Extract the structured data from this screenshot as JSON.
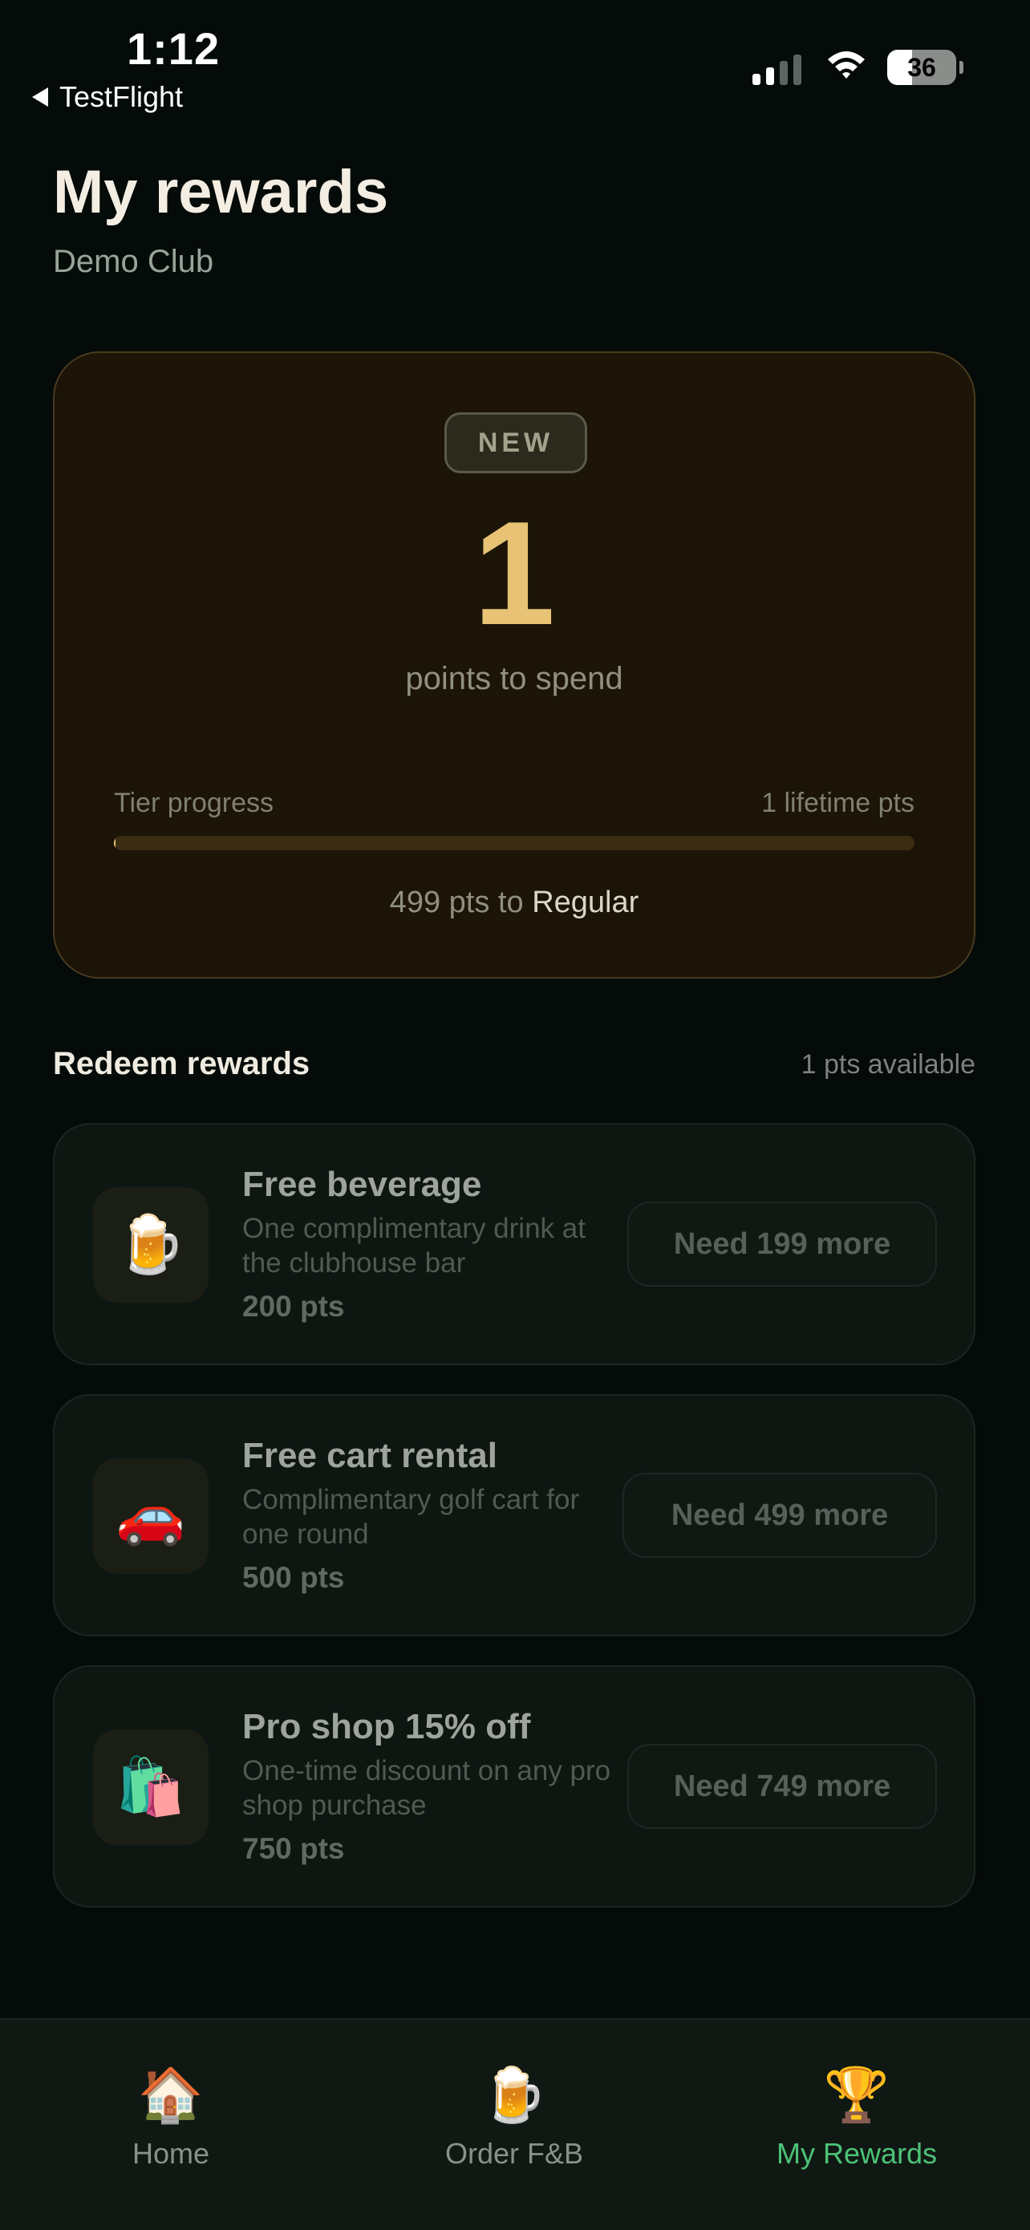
{
  "status_bar": {
    "time": "1:12",
    "back_label": "TestFlight",
    "battery_level": "36",
    "battery_fraction": 0.36
  },
  "header": {
    "title": "My rewards",
    "subtitle": "Demo Club"
  },
  "points_card": {
    "tier_badge": "NEW",
    "points": "1",
    "points_label": "points to spend",
    "tier_progress_label": "Tier progress",
    "lifetime_points": "1 lifetime pts",
    "progress_fraction": 0.002,
    "to_next_prefix": "499 pts to",
    "next_tier": "Regular"
  },
  "redeem": {
    "title": "Redeem rewards",
    "available": "1 pts available",
    "items": [
      {
        "name": "Free beverage",
        "description": "One complimentary drink at the clubhouse bar",
        "cost": "200 pts",
        "button": "Need 199 more",
        "icon": "beer-mug-icon",
        "glyph": "🍺"
      },
      {
        "name": "Free cart rental",
        "description": "Complimentary golf cart for one round",
        "cost": "500 pts",
        "button": "Need 499 more",
        "icon": "car-icon",
        "glyph": "🚗"
      },
      {
        "name": "Pro shop 15% off",
        "description": "One-time discount on any pro shop purchase",
        "cost": "750 pts",
        "button": "Need 749 more",
        "icon": "shopping-bags-icon",
        "glyph": "🛍️"
      }
    ]
  },
  "tabbar": {
    "tabs": [
      {
        "label": "Home",
        "icon": "house-icon",
        "glyph": "🏠"
      },
      {
        "label": "Order F&B",
        "icon": "beer-mug-icon",
        "glyph": "🍺"
      },
      {
        "label": "My Rewards",
        "icon": "trophy-icon",
        "glyph": "🏆"
      }
    ],
    "active": "My Rewards"
  },
  "colors": {
    "background": "#050b09",
    "accent_gold": "#e8c275",
    "active_tab": "#4cc277",
    "card_background": "#1b1407"
  }
}
